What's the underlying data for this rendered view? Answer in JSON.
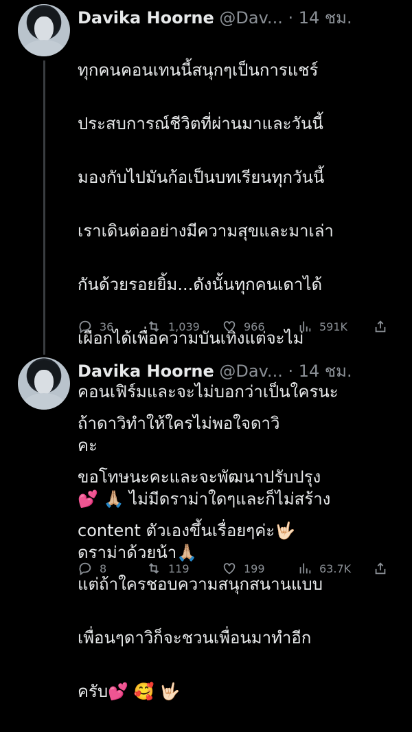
{
  "tweets": [
    {
      "name": "Davika Hoorne",
      "handle": "@Dav...",
      "time": "· 14 ชม.",
      "lines": [
        "ทุกคนคอนเทนนี้สนุกๆเป็นการแชร์",
        "ประสบการณ์ชีวิตที่ผ่านมาและวันนี้",
        "มองกับไปมันก้อเป็นบทเรียนทุกวันนี้",
        "เราเดินต่ออย่างมีความสุขและมาเล่า",
        "กันด้วยรอยยิ้ม...ดังนั้นทุกคนเดาได้",
        "เผือกได้เพื่อความบันเทิงแต่จะไม่",
        "คอนเฟิร์มและจะไม่บอกว่าเป็นใครนะ",
        "คะ",
        "💕 🙏🏼 ไม่มีดราม่าใดๆและก็ไม่สร้าง",
        "ดราม่าด้วยน้า🙏🏼"
      ],
      "replies": "36",
      "retweets": "1,039",
      "likes": "966",
      "views": "591K"
    },
    {
      "name": "Davika Hoorne",
      "handle": "@Dav...",
      "time": "· 14 ชม.",
      "lines": [
        "ถ้าดาวิทำให้ใครไม่พอใจดาวิ",
        "ขอโทษนะคะและจะพัฒนาปรับปรุง",
        "content ตัวเองขึ้นเรื่อยๆค่ะ🤟🏻",
        "แต่ถ้าใครชอบความสนุกสนานแบบ",
        "เพื่อนๆดาวิก็จะชวนเพื่อนมาทำอีก",
        "ครับ💕 🥰 🤟🏻"
      ],
      "replies": "8",
      "retweets": "119",
      "likes": "199",
      "views": "63.7K"
    }
  ],
  "icons": {
    "reply": "reply-icon",
    "retweet": "retweet-icon",
    "like": "heart-icon",
    "views": "views-icon",
    "share": "share-icon"
  }
}
